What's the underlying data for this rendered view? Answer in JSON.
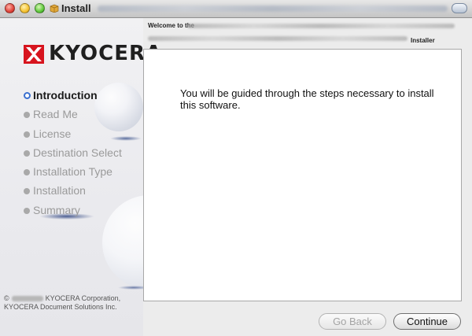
{
  "window": {
    "title": "Install"
  },
  "sidebar": {
    "logo_text": "KYOCERA",
    "steps": [
      {
        "label": "Introduction",
        "active": true
      },
      {
        "label": "Read Me",
        "active": false
      },
      {
        "label": "License",
        "active": false
      },
      {
        "label": "Destination Select",
        "active": false
      },
      {
        "label": "Installation Type",
        "active": false
      },
      {
        "label": "Installation",
        "active": false
      },
      {
        "label": "Summary",
        "active": false
      }
    ],
    "copyright_symbol": "©",
    "copyright_line1": "KYOCERA Corporation,",
    "copyright_line2": "KYOCERA Document Solutions Inc."
  },
  "header": {
    "welcome_prefix": "Welcome to the",
    "installer_word": "Installer"
  },
  "main": {
    "body_text": "You will be guided through the steps necessary to install this software."
  },
  "buttons": {
    "go_back": "Go Back",
    "continue": "Continue"
  },
  "colors": {
    "accent_blue": "#3a6fcf",
    "kyocera_red": "#d7141e"
  }
}
